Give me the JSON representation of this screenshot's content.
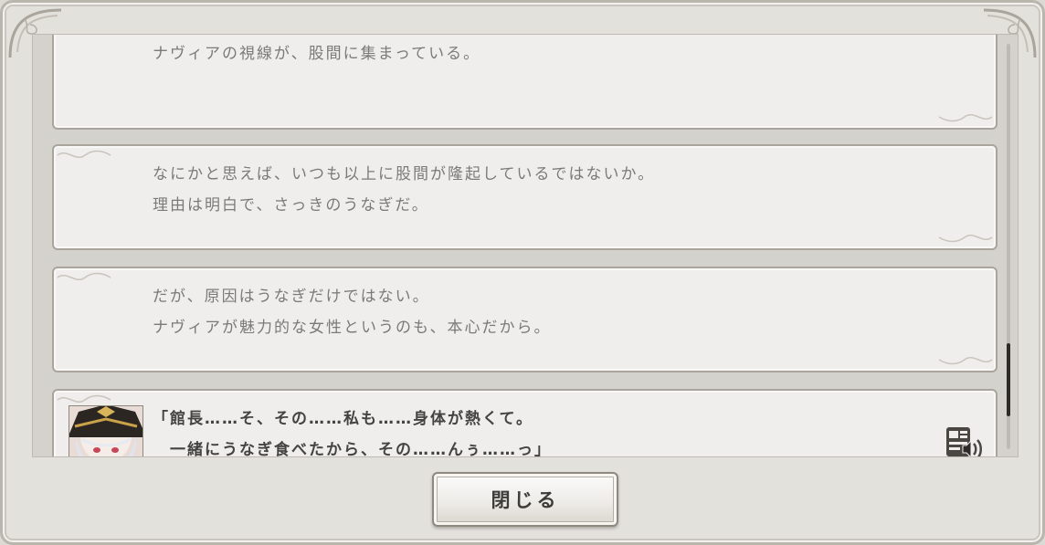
{
  "log": {
    "entries": [
      {
        "lines": [
          "ナヴィアの視線が、股間に集まっている。"
        ]
      },
      {
        "lines": [
          "なにかと思えば、いつも以上に股間が隆起しているではないか。",
          "理由は明白で、さっきのうなぎだ。"
        ]
      },
      {
        "lines": [
          "だが、原因はうなぎだけではない。",
          "ナヴィアが魅力的な女性というのも、本心だから。"
        ]
      },
      {
        "lines": [
          "「館長……そ、その……私も……身体が熱くて。",
          "　一緒にうなぎ食べたから、その……んぅ……っ」"
        ],
        "voiced": true
      }
    ]
  },
  "buttons": {
    "close_label": "閉じる"
  },
  "colors": {
    "accent_text": "#45433f",
    "muted_text": "#7c7a76",
    "panel": "#efeeec",
    "frame": "#e3e1dc"
  },
  "icons": {
    "voice": "voice-replay-icon",
    "ornament": "scroll-ornament-icon"
  }
}
